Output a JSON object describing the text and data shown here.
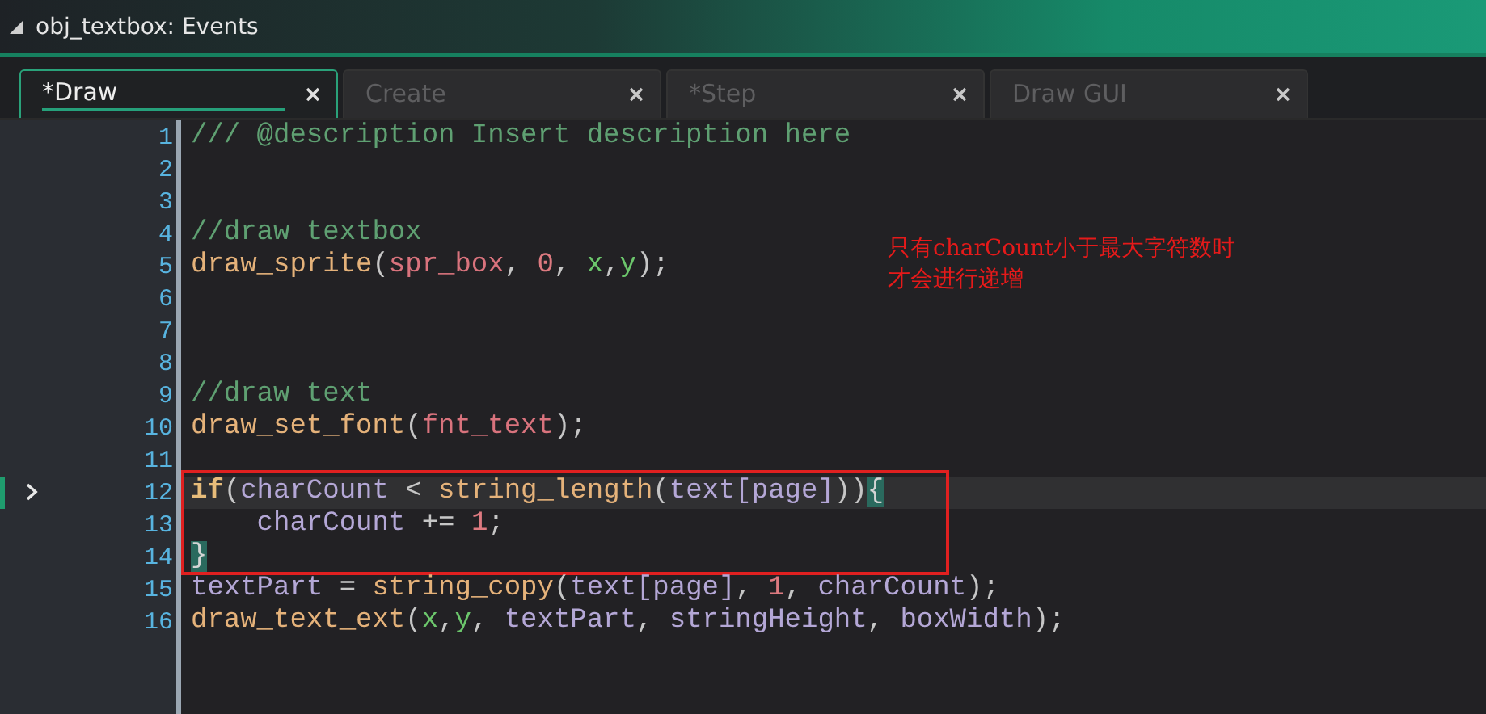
{
  "window": {
    "title": "obj_textbox: Events"
  },
  "tabs": [
    {
      "label": "*Draw",
      "selected": true
    },
    {
      "label": "Create",
      "selected": false
    },
    {
      "label": "*Step",
      "selected": false
    },
    {
      "label": "Draw GUI",
      "selected": false
    }
  ],
  "editor": {
    "lines": [
      {
        "number": "1",
        "current": false,
        "marked": false,
        "tokens": [
          {
            "kind": "comment",
            "text": "/// @description Insert description here"
          }
        ]
      },
      {
        "number": "2",
        "current": false,
        "marked": false
      },
      {
        "number": "3",
        "current": false,
        "marked": false
      },
      {
        "number": "4",
        "current": false,
        "marked": false,
        "tokens": [
          {
            "kind": "comment",
            "text": "//draw textbox"
          }
        ]
      },
      {
        "number": "5",
        "current": false,
        "marked": false,
        "tokens": [
          {
            "kind": "func",
            "text": "draw_sprite"
          },
          {
            "kind": "punct",
            "text": "("
          },
          {
            "kind": "resource",
            "text": "spr_box"
          },
          {
            "kind": "punct",
            "text": ", "
          },
          {
            "kind": "number",
            "text": "0"
          },
          {
            "kind": "punct",
            "text": ", "
          },
          {
            "kind": "builtin",
            "text": "x"
          },
          {
            "kind": "punct",
            "text": ","
          },
          {
            "kind": "builtin",
            "text": "y"
          },
          {
            "kind": "punct",
            "text": ");"
          }
        ]
      },
      {
        "number": "6",
        "current": false,
        "marked": false
      },
      {
        "number": "7",
        "current": false,
        "marked": false
      },
      {
        "number": "8",
        "current": false,
        "marked": false
      },
      {
        "number": "9",
        "current": false,
        "marked": false,
        "tokens": [
          {
            "kind": "comment",
            "text": "//draw text"
          }
        ]
      },
      {
        "number": "10",
        "current": false,
        "marked": false,
        "tokens": [
          {
            "kind": "func",
            "text": "draw_set_font"
          },
          {
            "kind": "punct",
            "text": "("
          },
          {
            "kind": "resource",
            "text": "fnt_text"
          },
          {
            "kind": "punct",
            "text": ");"
          }
        ]
      },
      {
        "number": "11",
        "current": false,
        "marked": false
      },
      {
        "number": "12",
        "current": true,
        "marked": true,
        "tokens": [
          {
            "kind": "keyword",
            "text": "if"
          },
          {
            "kind": "punct",
            "text": "("
          },
          {
            "kind": "variable",
            "text": "charCount"
          },
          {
            "kind": "punct",
            "text": " < "
          },
          {
            "kind": "func",
            "text": "string_length"
          },
          {
            "kind": "punct",
            "text": "("
          },
          {
            "kind": "variable",
            "text": "text[page]"
          },
          {
            "kind": "punct",
            "text": "))"
          },
          {
            "kind": "brace",
            "text": "{"
          }
        ]
      },
      {
        "number": "13",
        "current": false,
        "marked": true,
        "tokens": [
          {
            "kind": "variable",
            "text": "    charCount"
          },
          {
            "kind": "punct",
            "text": " += "
          },
          {
            "kind": "number",
            "text": "1"
          },
          {
            "kind": "punct",
            "text": ";"
          }
        ]
      },
      {
        "number": "14",
        "current": false,
        "marked": true,
        "tokens": [
          {
            "kind": "brace",
            "text": "}"
          }
        ]
      },
      {
        "number": "15",
        "current": false,
        "marked": false,
        "tokens": [
          {
            "kind": "variable",
            "text": "textPart"
          },
          {
            "kind": "punct",
            "text": " = "
          },
          {
            "kind": "func",
            "text": "string_copy"
          },
          {
            "kind": "punct",
            "text": "("
          },
          {
            "kind": "variable",
            "text": "text[page]"
          },
          {
            "kind": "punct",
            "text": ", "
          },
          {
            "kind": "number",
            "text": "1"
          },
          {
            "kind": "punct",
            "text": ", "
          },
          {
            "kind": "variable",
            "text": "charCount"
          },
          {
            "kind": "punct",
            "text": ");"
          }
        ]
      },
      {
        "number": "16",
        "current": false,
        "marked": false,
        "tokens": [
          {
            "kind": "func",
            "text": "draw_text_ext"
          },
          {
            "kind": "punct",
            "text": "("
          },
          {
            "kind": "builtin",
            "text": "x"
          },
          {
            "kind": "punct",
            "text": ","
          },
          {
            "kind": "builtin",
            "text": "y"
          },
          {
            "kind": "punct",
            "text": ", "
          },
          {
            "kind": "variable",
            "text": "textPart"
          },
          {
            "kind": "punct",
            "text": ", "
          },
          {
            "kind": "variable",
            "text": "stringHeight"
          },
          {
            "kind": "punct",
            "text": ", "
          },
          {
            "kind": "variable",
            "text": "boxWidth"
          },
          {
            "kind": "punct",
            "text": ");"
          }
        ]
      }
    ]
  },
  "annotation": {
    "lines": [
      "只有charCount小于最大字符数时",
      "才会进行递增"
    ]
  }
}
